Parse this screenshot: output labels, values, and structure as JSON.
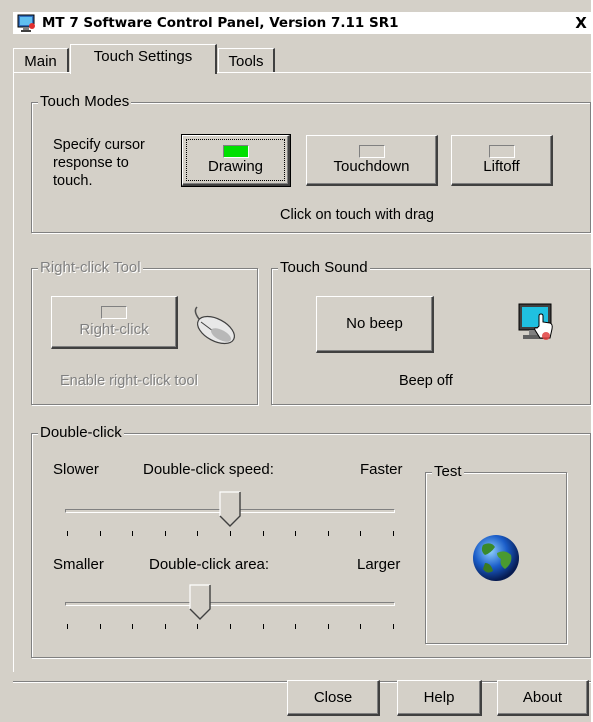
{
  "window": {
    "title": "MT 7 Software Control Panel, Version 7.11 SR1",
    "close_glyph": "X"
  },
  "tabs": [
    {
      "label": "Main"
    },
    {
      "label": "Touch Settings",
      "active": true
    },
    {
      "label": "Tools"
    }
  ],
  "touch_modes": {
    "legend": "Touch Modes",
    "description": "Specify cursor response to touch.",
    "description_lines": [
      "Specify cursor",
      "response to",
      "touch."
    ],
    "buttons": [
      {
        "label": "Drawing",
        "active": true
      },
      {
        "label": "Touchdown",
        "active": false
      },
      {
        "label": "Liftoff",
        "active": false
      }
    ],
    "status": "Click on touch with drag",
    "led_on_color": "#00e000"
  },
  "right_click": {
    "legend": "Right-click Tool",
    "button_label": "Right-click",
    "status": "Enable right-click tool",
    "icon": "mouse-icon"
  },
  "touch_sound": {
    "legend": "Touch Sound",
    "button_label": "No beep",
    "status": "Beep off",
    "icon": "touch-monitor-icon"
  },
  "double_click": {
    "legend": "Double-click",
    "speed": {
      "label": "Double-click speed:",
      "min_label": "Slower",
      "max_label": "Faster",
      "value_fraction": 0.5
    },
    "area": {
      "label": "Double-click area:",
      "min_label": "Smaller",
      "max_label": "Larger",
      "value_fraction": 0.41
    },
    "test": {
      "legend": "Test",
      "icon": "globe-icon"
    }
  },
  "footer": {
    "close": "Close",
    "help": "Help",
    "about": "About"
  }
}
